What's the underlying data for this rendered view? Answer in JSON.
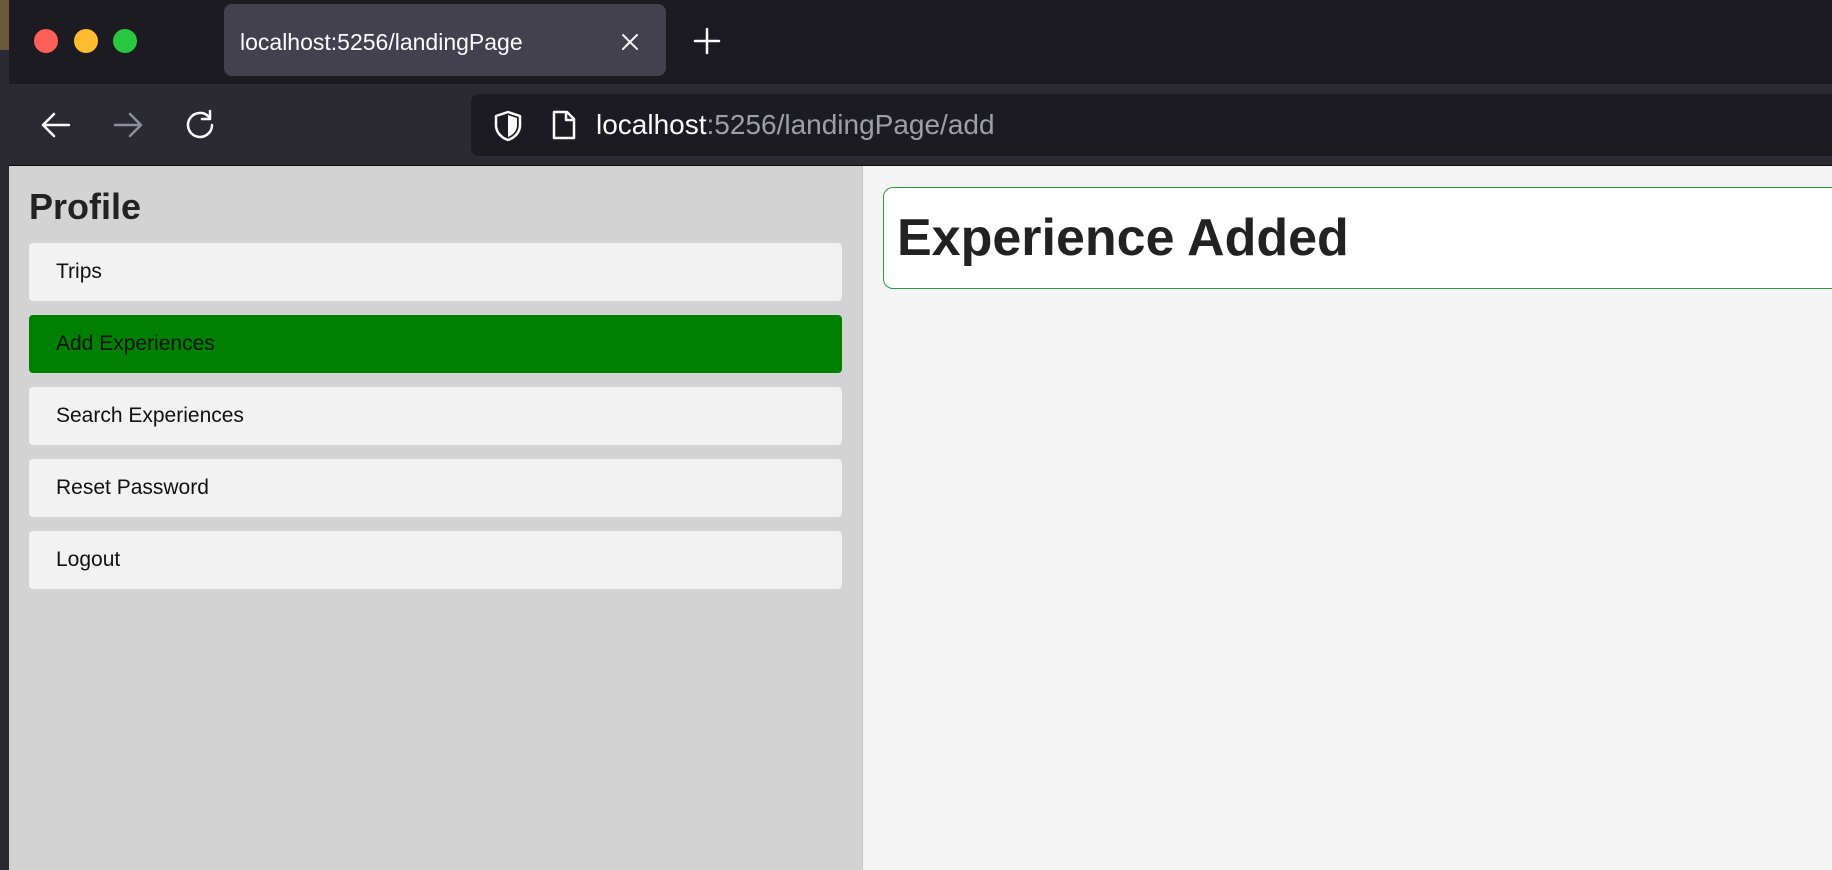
{
  "browser": {
    "tab": {
      "title": "localhost:5256/landingPage"
    },
    "url": {
      "host": "localhost",
      "rest": ":5256/landingPage/add"
    },
    "icons": {
      "close": "close-icon",
      "new_tab": "plus-icon",
      "back": "arrow-left-icon",
      "forward": "arrow-right-icon",
      "reload": "reload-icon",
      "shield": "shield-icon",
      "page": "page-icon"
    }
  },
  "sidebar": {
    "title": "Profile",
    "items": [
      {
        "label": "Trips",
        "active": false
      },
      {
        "label": "Add Experiences",
        "active": true
      },
      {
        "label": "Search Experiences",
        "active": false
      },
      {
        "label": "Reset Password",
        "active": false
      },
      {
        "label": "Logout",
        "active": false
      }
    ]
  },
  "main": {
    "notice": "Experience Added"
  },
  "colors": {
    "active_item": "#008000",
    "notice_border": "#2e9b3a",
    "sidebar_bg": "#d3d3d3",
    "content_bg": "#f4f4f4"
  }
}
